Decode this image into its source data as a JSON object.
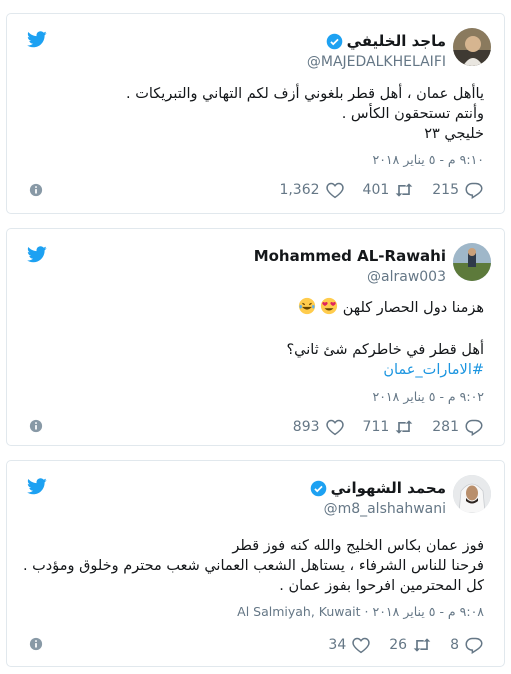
{
  "colors": {
    "twitter_blue": "#1da1f2",
    "text": "#14171a",
    "muted": "#657786",
    "link": "#1b95e0",
    "border": "#e1e8ed"
  },
  "tweets": [
    {
      "name": "ماجد الخليفي",
      "verified": true,
      "handle": "@MAJEDALKHELAIFI",
      "lines": [
        "ياأهل عمان ، أهل قطر بلغوني أزف لكم التهاني والتبريكات .",
        "وأنتم تستحقون الكأس .",
        "خليجي ٢٣"
      ],
      "meta": "٩:١٠ م - ٥ يناير ٢٠١٨",
      "likes": "1,362",
      "retweets": "401",
      "replies": "215"
    },
    {
      "name": "Mohammed AL-Rawahi",
      "verified": false,
      "handle": "@alraw003",
      "lines": [
        "هزمنا دول الحصار كلهن",
        "",
        "أهل قطر في خاطركم شئ ثاني؟",
        "#الامارات_عمان"
      ],
      "meta": "٩:٠٢ م - ٥ يناير ٢٠١٨",
      "likes": "893",
      "retweets": "711",
      "replies": "281"
    },
    {
      "name": "محمد الشهواني",
      "verified": true,
      "handle": "@m8_alshahwani",
      "lines": [
        "فوز عمان بكاس الخليج والله كنه فوز قطر",
        "فرحنا للناس الشرفاء ، يستاهل الشعب العماني شعب محترم وخلوق ومؤدب .",
        "كل المحترمين افرحوا بفوز عمان ."
      ],
      "meta": "٩:٠٨ م - ٥ يناير ٢٠١٨",
      "location": "Al Salmiyah, Kuwait",
      "likes": "34",
      "retweets": "26",
      "replies": "8"
    }
  ]
}
